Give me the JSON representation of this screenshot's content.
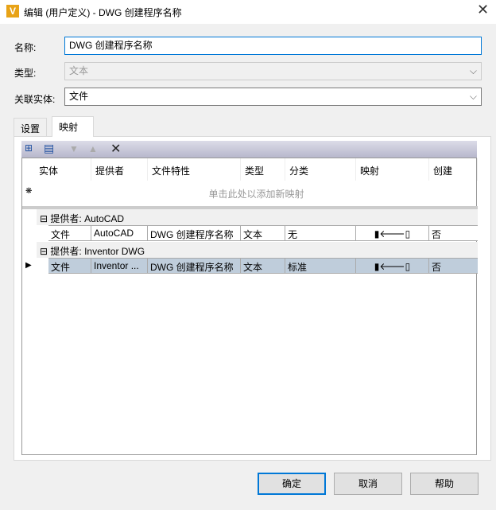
{
  "window": {
    "title": "编辑 (用户定义) - DWG 创建程序名称",
    "logo": "V"
  },
  "form": {
    "name_label": "名称:",
    "name_value": "DWG 创建程序名称",
    "type_label": "类型:",
    "type_value": "文本",
    "entity_label": "关联实体:",
    "entity_value": "文件"
  },
  "tabs": [
    {
      "label": "设置"
    },
    {
      "label": "映射"
    }
  ],
  "grid": {
    "columns": [
      "实体",
      "提供者",
      "文件特性",
      "类型",
      "分类",
      "映射",
      "创建"
    ],
    "new_row_hint": "单击此处以添加新映射",
    "groups": [
      {
        "label": "提供者: AutoCAD",
        "row": [
          "文件",
          "AutoCAD",
          "DWG 创建程序名称",
          "文本",
          "无",
          "否"
        ]
      },
      {
        "label": "提供者: Inventor DWG",
        "row": [
          "文件",
          "Inventor ...",
          "DWG 创建程序名称",
          "文本",
          "标准",
          "否"
        ]
      }
    ]
  },
  "buttons": {
    "ok": "确定",
    "cancel": "取消",
    "help": "帮助"
  }
}
